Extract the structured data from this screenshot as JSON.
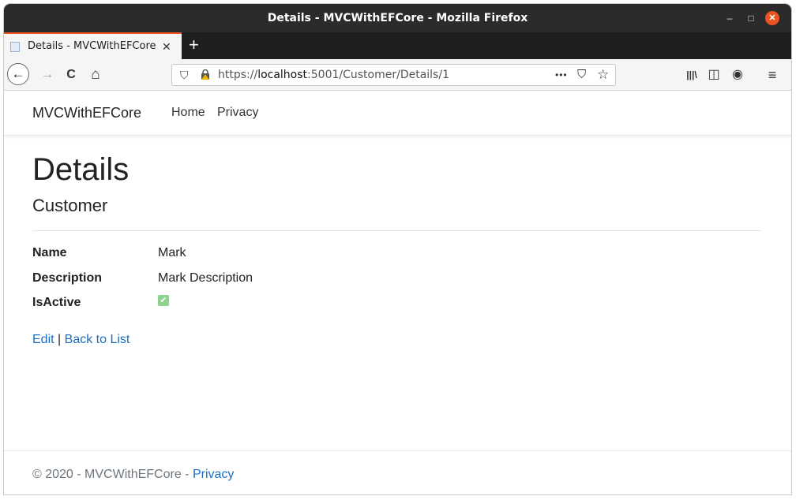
{
  "window": {
    "title": "Details - MVCWithEFCore - Mozilla Firefox"
  },
  "tab": {
    "title": "Details - MVCWithEFCore",
    "close": "✕",
    "new_tab": "+"
  },
  "nav": {
    "back": "←",
    "forward": "→",
    "reload": "C",
    "home": "⌂",
    "url_prefix": "https://",
    "url_host": "localhost",
    "url_rest": ":5001/Customer/Details/1",
    "more": "•••",
    "pocket": "⛉",
    "bookmark": "☆",
    "library": "|||\\",
    "sidebar": "◫",
    "account": "◉",
    "menu": "≡"
  },
  "site": {
    "brand": "MVCWithEFCore",
    "nav_home": "Home",
    "nav_privacy": "Privacy"
  },
  "content": {
    "heading": "Details",
    "subheading": "Customer",
    "fields": [
      {
        "label": "Name",
        "value": "Mark"
      },
      {
        "label": "Description",
        "value": "Mark Description"
      },
      {
        "label": "IsActive",
        "checked": true
      }
    ],
    "edit_link": "Edit",
    "separator": "|",
    "back_link": "Back to List"
  },
  "footer": {
    "text": "© 2020 - MVCWithEFCore -",
    "privacy_link": "Privacy"
  },
  "colors": {
    "accent": "#e95420",
    "link": "#1b6ec2",
    "check": "#8dd28d"
  }
}
